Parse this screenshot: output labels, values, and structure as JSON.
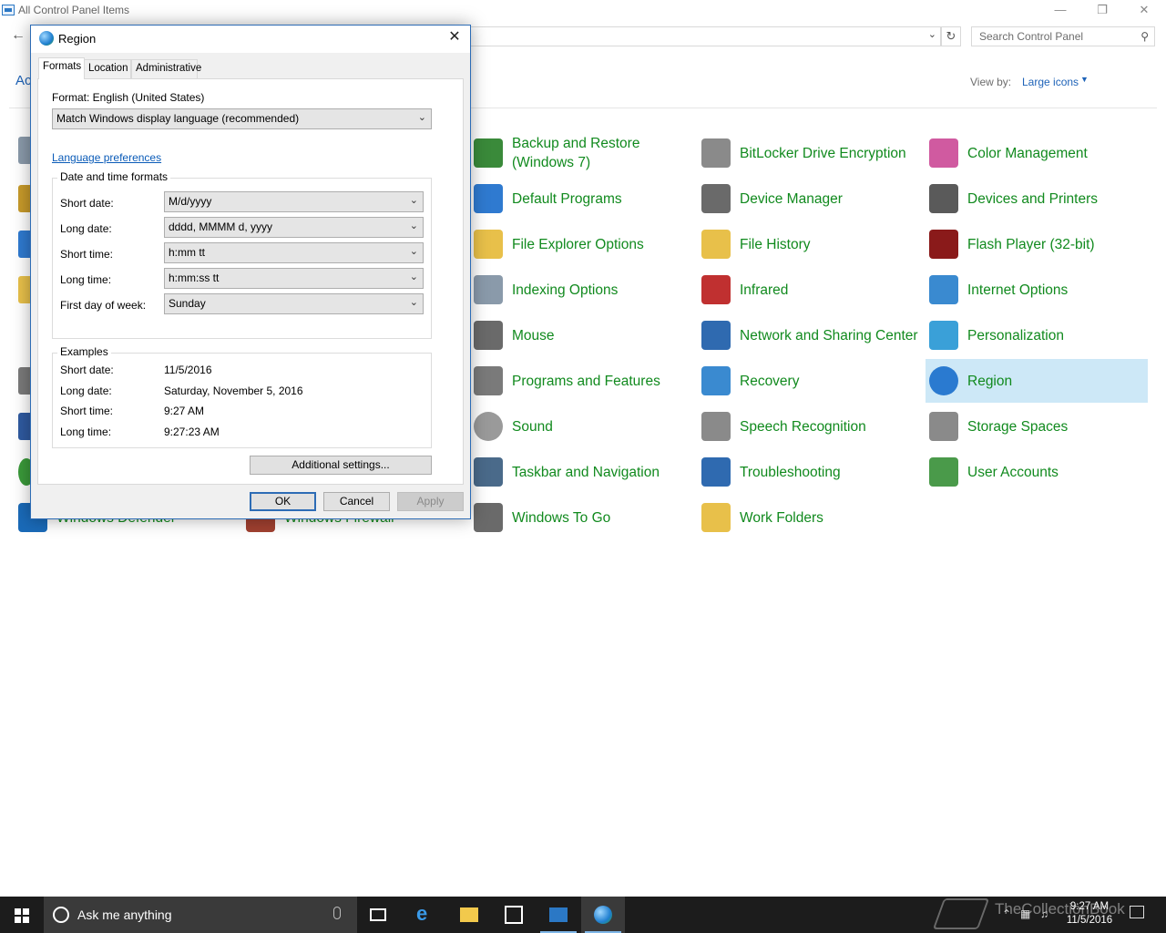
{
  "cp": {
    "title": "All Control Panel Items",
    "search_placeholder": "Search Control Panel",
    "adjust_text": "Ac",
    "viewby_label": "View by:",
    "viewby_value": "Large icons",
    "items": [
      {
        "label": "Backup and Restore (Windows 7)",
        "color": "#3a8a3a"
      },
      {
        "label": "BitLocker Drive Encryption",
        "color": "#8a8a8a"
      },
      {
        "label": "Color Management",
        "color": "#d05aa0"
      },
      {
        "label": "Default Programs",
        "color": "#2f7ad0"
      },
      {
        "label": "Device Manager",
        "color": "#6a6a6a"
      },
      {
        "label": "Devices and Printers",
        "color": "#5a5a5a"
      },
      {
        "label": "File Explorer Options",
        "color": "#e8c04a"
      },
      {
        "label": "File History",
        "color": "#e8c04a"
      },
      {
        "label": "Flash Player (32-bit)",
        "color": "#8a1a1a"
      },
      {
        "label": "Indexing Options",
        "color": "#8a9aaa"
      },
      {
        "label": "Infrared",
        "color": "#c03030"
      },
      {
        "label": "Internet Options",
        "color": "#3a8ad0"
      },
      {
        "label": "Mouse",
        "color": "#6a6a6a"
      },
      {
        "label": "Network and Sharing Center",
        "color": "#2f6ab0"
      },
      {
        "label": "Personalization",
        "color": "#3aa0d8"
      },
      {
        "label": "Programs and Features",
        "color": "#7a7a7a"
      },
      {
        "label": "Recovery",
        "color": "#3a8ad0"
      },
      {
        "label": "Region",
        "color": "#2a7ad0"
      },
      {
        "label": "Sound",
        "color": "#9a9a9a"
      },
      {
        "label": "Speech Recognition",
        "color": "#8a8a8a"
      },
      {
        "label": "Storage Spaces",
        "color": "#8a8a8a"
      },
      {
        "label": "Taskbar and Navigation",
        "color": "#4a6a8a"
      },
      {
        "label": "Troubleshooting",
        "color": "#2f6ab0"
      },
      {
        "label": "User Accounts",
        "color": "#4a9a4a"
      },
      {
        "label": "Windows To Go",
        "color": "#6a6a6a"
      },
      {
        "label": "Work Folders",
        "color": "#e8c04a"
      }
    ],
    "left_items": [
      {
        "label": "Windows Defender",
        "color": "#1a6ab8"
      },
      {
        "label": "Windows Firewall",
        "color": "#a04030"
      }
    ]
  },
  "dialog": {
    "title": "Region",
    "tabs": [
      "Formats",
      "Location",
      "Administrative"
    ],
    "format_label": "Format: English (United States)",
    "format_value": "Match Windows display language (recommended)",
    "language_link": "Language preferences",
    "datetime_group": "Date and time formats",
    "fields": [
      {
        "label": "Short date:",
        "value": "M/d/yyyy"
      },
      {
        "label": "Long date:",
        "value": "dddd, MMMM d, yyyy"
      },
      {
        "label": "Short time:",
        "value": "h:mm tt"
      },
      {
        "label": "Long time:",
        "value": "h:mm:ss tt"
      },
      {
        "label": "First day of week:",
        "value": "Sunday"
      }
    ],
    "examples_group": "Examples",
    "examples": [
      {
        "label": "Short date:",
        "value": "11/5/2016"
      },
      {
        "label": "Long date:",
        "value": "Saturday, November 5, 2016"
      },
      {
        "label": "Short time:",
        "value": "9:27 AM"
      },
      {
        "label": "Long time:",
        "value": "9:27:23 AM"
      }
    ],
    "additional_btn": "Additional settings...",
    "ok_btn": "OK",
    "cancel_btn": "Cancel",
    "apply_btn": "Apply"
  },
  "taskbar": {
    "search_text": "Ask me anything",
    "time": "9:27 AM",
    "date": "11/5/2016",
    "watermark": "TheCollectionBook"
  }
}
